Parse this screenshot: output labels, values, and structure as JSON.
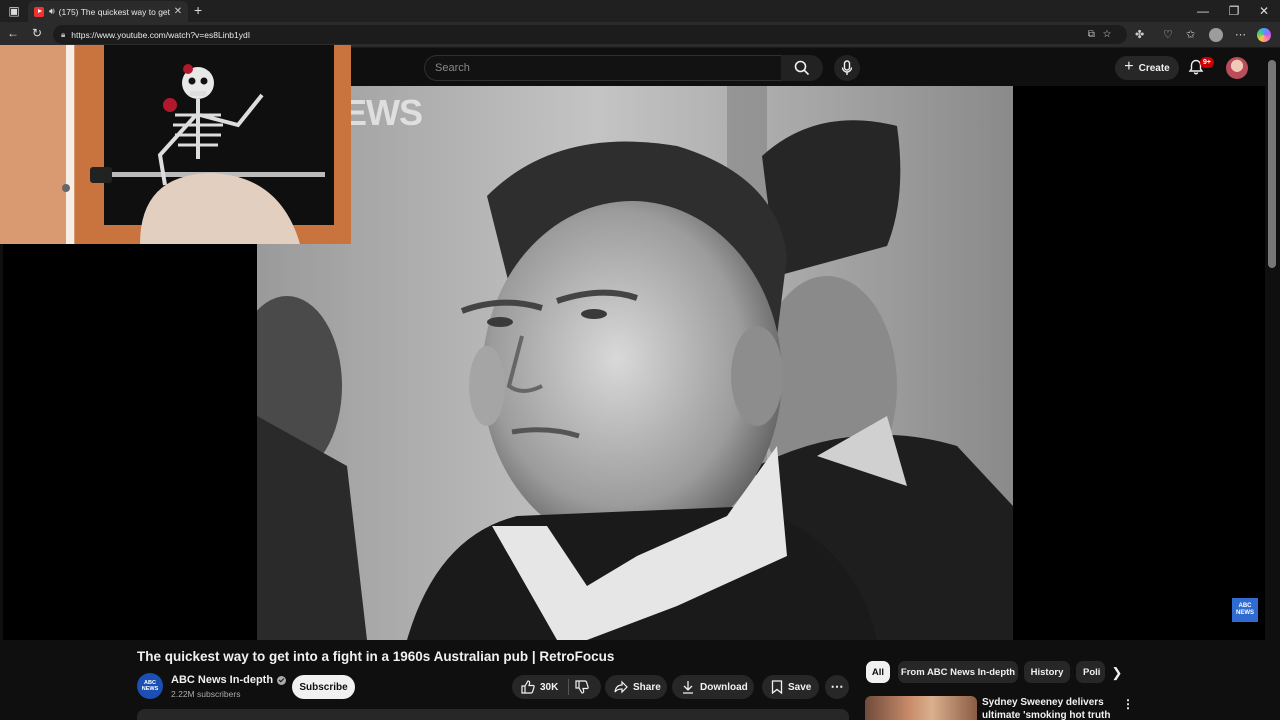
{
  "browser": {
    "tab_title": "(175) The quickest way to get into a fight in a 1960s Australian pub | RetroFocus",
    "url": "https://www.youtube.com/watch?v=es8Linb1ydI"
  },
  "masthead": {
    "search_placeholder": "Search",
    "create_label": "Create",
    "notification_badge": "9+"
  },
  "video": {
    "watermark": "EWS",
    "corner_logo_top": "ABC",
    "corner_logo_bottom": "NEWS",
    "title": "The quickest way to get into a fight in a 1960s Australian pub | RetroFocus"
  },
  "channel": {
    "avatar_top": "ABC",
    "avatar_bottom": "NEWS",
    "name": "ABC News In-depth",
    "subscribers": "2.22M subscribers",
    "subscribe_label": "Subscribe"
  },
  "actions": {
    "like_count": "30K",
    "share_label": "Share",
    "download_label": "Download",
    "save_label": "Save"
  },
  "chips": [
    "All",
    "From ABC News In-depth",
    "History",
    "Poli"
  ],
  "recommendation": {
    "title": "Sydney Sweeney delivers ultimate 'smoking hot truth"
  },
  "colors": {
    "background": "#0f0f0f",
    "youtube_red": "#cc0000",
    "abc_blue": "#1c4fb3"
  }
}
